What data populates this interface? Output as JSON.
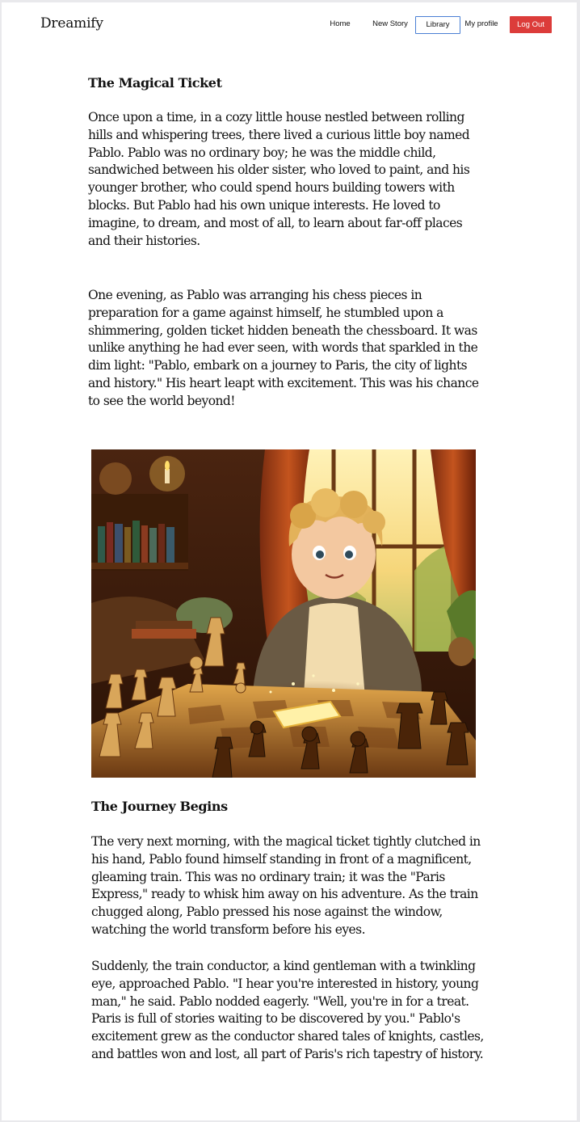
{
  "header": {
    "brand": "Dreamify",
    "nav": {
      "home": "Home",
      "new_story": "New Story",
      "library": "Library",
      "my_profile": "My profile",
      "log_out": "Log Out"
    }
  },
  "story": {
    "sections": [
      {
        "title": "The Magical Ticket",
        "paragraphs": [
          "Once upon a time, in a cozy little house nestled between rolling hills and whispering trees, there lived a curious little boy named Pablo. Pablo was no ordinary boy; he was the middle child, sandwiched between his older sister, who loved to paint, and his younger brother, who could spend hours building towers with blocks. But Pablo had his own unique interests. He loved to imagine, to dream, and most of all, to learn about far-off places and their histories.",
          "One evening, as Pablo was arranging his chess pieces in preparation for a game against himself, he stumbled upon a shimmering, golden ticket hidden beneath the chessboard. It was unlike anything he had ever seen, with words that sparkled in the dim light: \"Pablo, embark on a journey to Paris, the city of lights and history.\" His heart leapt with excitement. This was his chance to see the world beyond!"
        ]
      },
      {
        "title": "The Journey Begins",
        "paragraphs": [
          "The very next morning, with the magical ticket tightly clutched in his hand, Pablo found himself standing in front of a magnificent, gleaming train. This was no ordinary train; it was the \"Paris Express,\" ready to whisk him away on his adventure. As the train chugged along, Pablo pressed his nose against the window, watching the world transform before his eyes.",
          "Suddenly, the train conductor, a kind gentleman with a twinkling eye, approached Pablo. \"I hear you're interested in history, young man,\" he said. Pablo nodded eagerly. \"Well, you're in for a treat. Paris is full of stories waiting to be discovered by you.\" Pablo's excitement grew as the conductor shared tales of knights, castles, and battles won and lost, all part of Paris's rich tapestry of history."
        ]
      }
    ]
  },
  "illustration": {
    "subject": "boy-with-golden-ticket-over-chessboard"
  },
  "colors": {
    "logout_bg": "#dc3c3a",
    "library_border": "#4a7fd4",
    "page_bg": "#ffffff"
  }
}
